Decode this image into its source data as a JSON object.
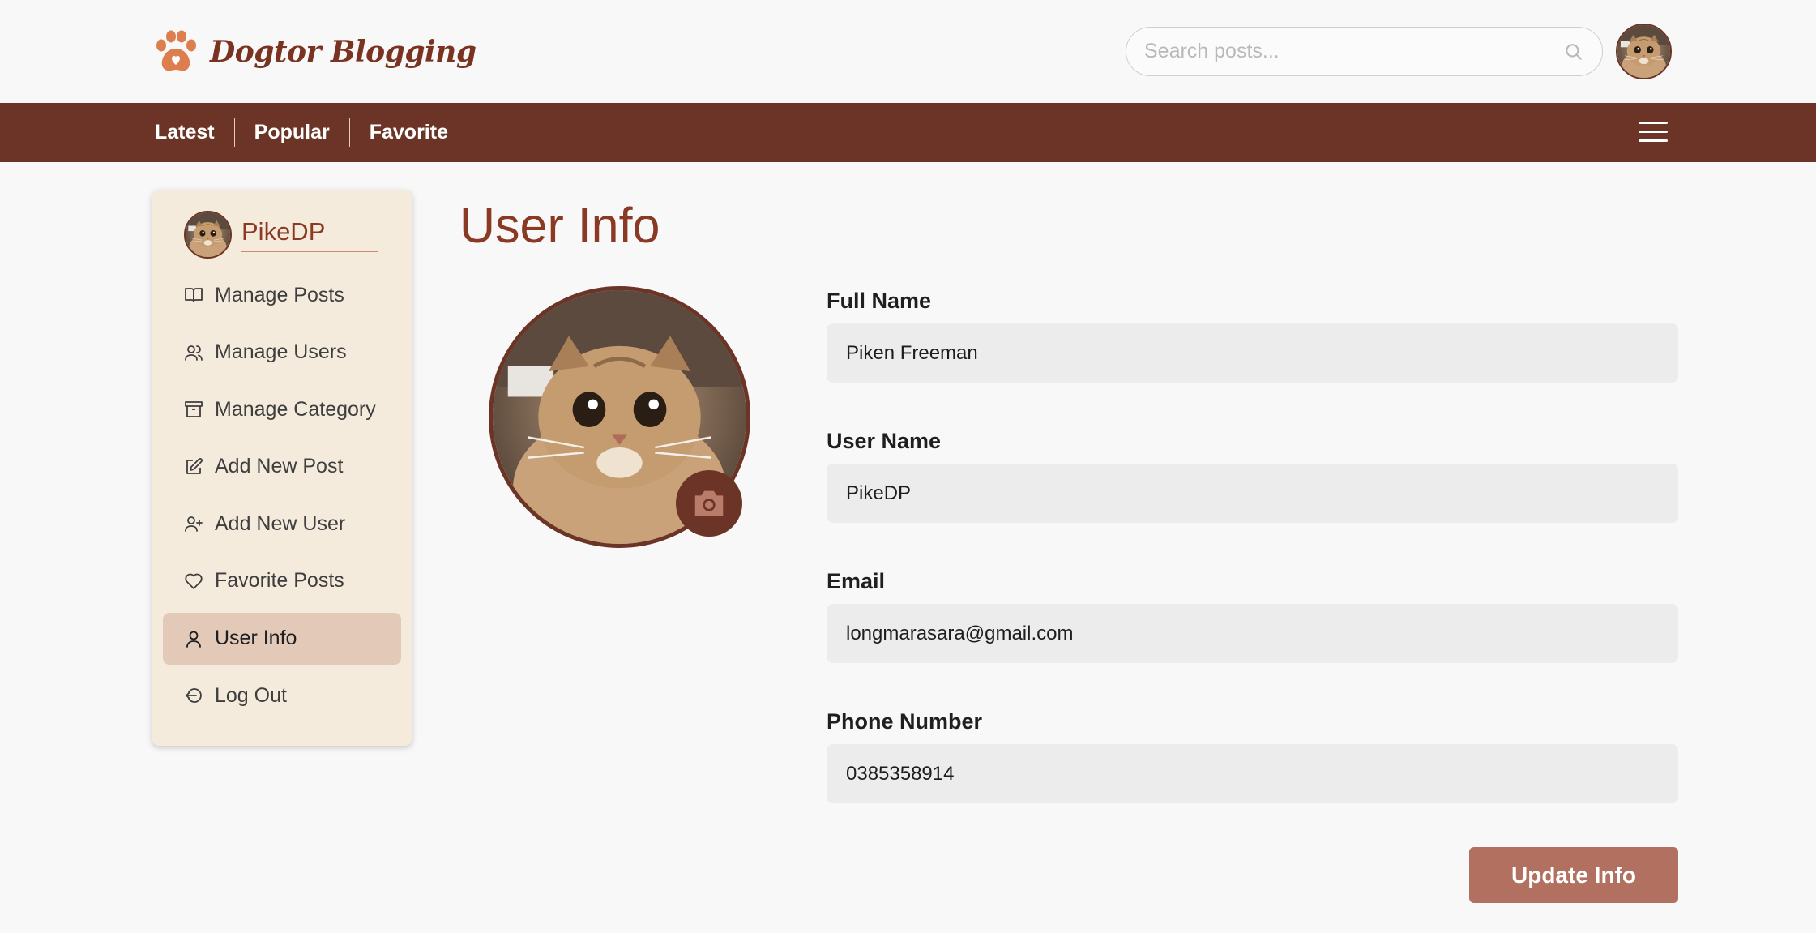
{
  "header": {
    "brand": "Dogtor Blogging",
    "search_placeholder": "Search posts..."
  },
  "nav": {
    "links": [
      "Latest",
      "Popular",
      "Favorite"
    ]
  },
  "sidebar": {
    "username": "PikeDP",
    "items": [
      {
        "label": "Manage Posts",
        "icon": "book-open-icon"
      },
      {
        "label": "Manage Users",
        "icon": "users-icon"
      },
      {
        "label": "Manage Category",
        "icon": "archive-icon"
      },
      {
        "label": "Add New Post",
        "icon": "edit-icon"
      },
      {
        "label": "Add New User",
        "icon": "user-plus-icon"
      },
      {
        "label": "Favorite Posts",
        "icon": "heart-icon"
      },
      {
        "label": "User Info",
        "icon": "user-icon",
        "active": true
      },
      {
        "label": "Log Out",
        "icon": "log-out-icon"
      }
    ]
  },
  "main": {
    "title": "User Info",
    "fields": [
      {
        "label": "Full Name",
        "value": "Piken Freeman"
      },
      {
        "label": "User Name",
        "value": "PikeDP"
      },
      {
        "label": "Email",
        "value": "longmarasara@gmail.com"
      },
      {
        "label": "Phone Number",
        "value": "0385358914"
      }
    ],
    "update_button": "Update Info"
  },
  "colors": {
    "brand_brown": "#6b3426",
    "title_brown": "#8a3a22",
    "sidebar_bg": "#f5ebdd",
    "active_item_bg": "#e3c9b8",
    "button_bg": "#b27060",
    "paw_orange": "#dd7e4e"
  }
}
